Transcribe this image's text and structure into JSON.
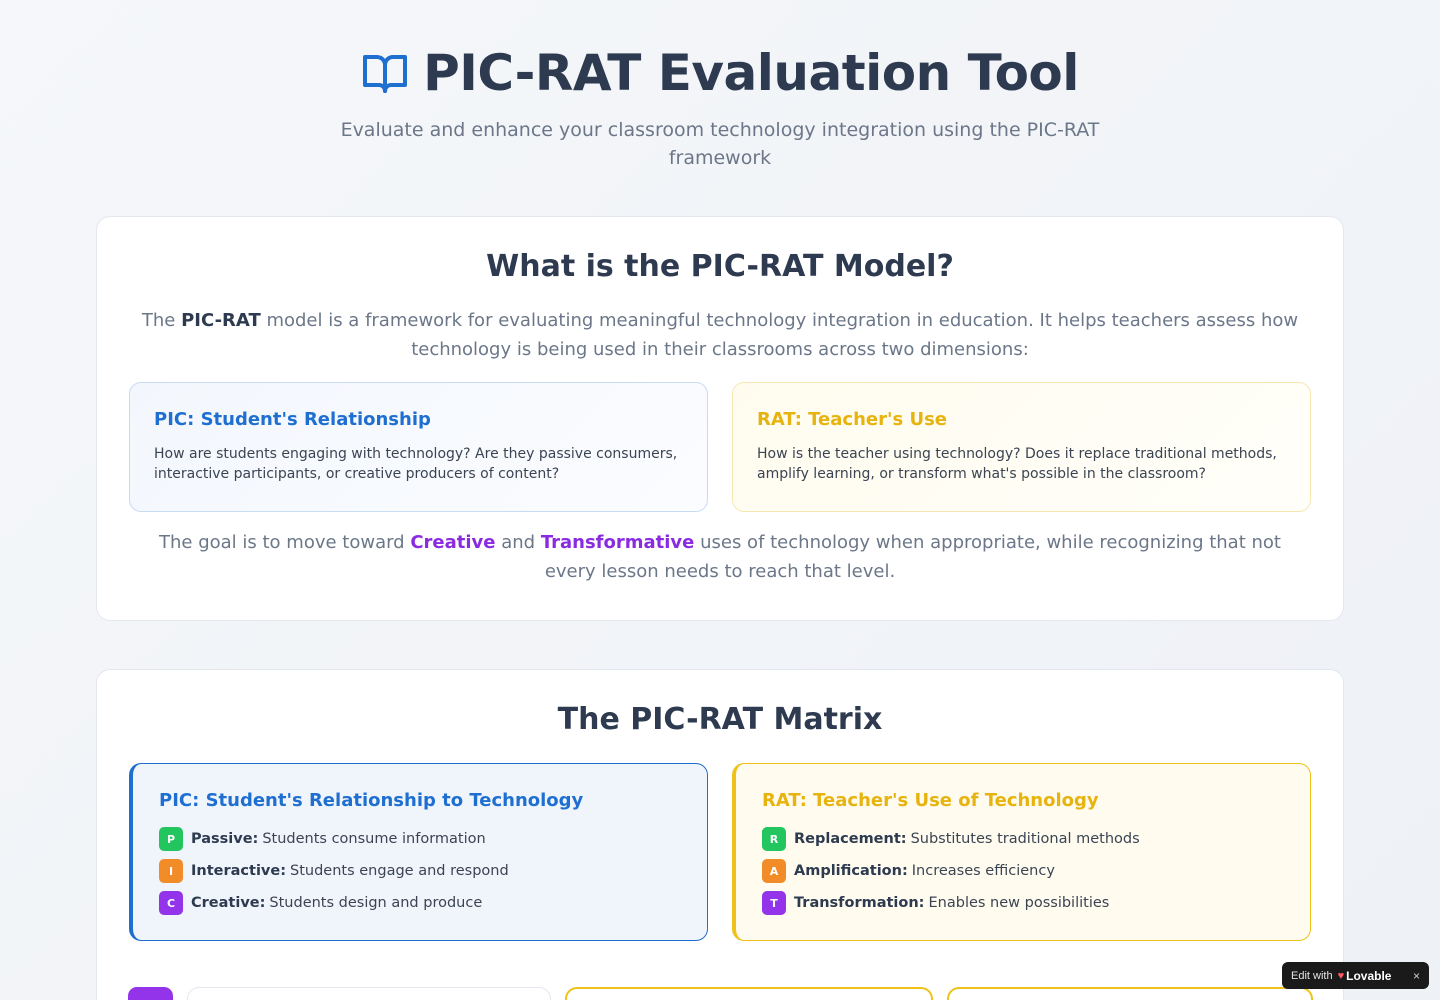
{
  "header": {
    "title": "PIC-RAT Evaluation Tool",
    "subtitle": "Evaluate and enhance your classroom technology integration using the PIC-RAT framework",
    "icon": "book-open-icon"
  },
  "about": {
    "heading": "What is the PIC-RAT Model?",
    "intro_pre": "The ",
    "intro_bold": "PIC-RAT",
    "intro_post": " model is a framework for evaluating meaningful technology integration in education. It helps teachers assess how technology is being used in their classrooms across two dimensions:",
    "pic": {
      "title": "PIC: Student's Relationship",
      "text": "How are students engaging with technology? Are they passive consumers, interactive participants, or creative producers of content?"
    },
    "rat": {
      "title": "RAT: Teacher's Use",
      "text": "How is the teacher using technology? Does it replace traditional methods, amplify learning, or transform what's possible in the classroom?"
    },
    "goal_pre": "The goal is to move toward ",
    "goal_h1": "Creative",
    "goal_mid": " and ",
    "goal_h2": "Transformative",
    "goal_post": " uses of technology when appropriate, while recognizing that not every lesson needs to reach that level."
  },
  "matrix": {
    "heading": "The PIC-RAT Matrix",
    "pic": {
      "title": "PIC: Student's Relationship to Technology",
      "items": [
        {
          "letter": "P",
          "label": "Passive:",
          "desc": "Students consume information"
        },
        {
          "letter": "I",
          "label": "Interactive:",
          "desc": "Students engage and respond"
        },
        {
          "letter": "C",
          "label": "Creative:",
          "desc": "Students design and produce"
        }
      ]
    },
    "rat": {
      "title": "RAT: Teacher's Use of Technology",
      "items": [
        {
          "letter": "R",
          "label": "Replacement:",
          "desc": "Substitutes traditional methods"
        },
        {
          "letter": "A",
          "label": "Amplification:",
          "desc": "Increases efficiency"
        },
        {
          "letter": "T",
          "label": "Transformation:",
          "desc": "Enables new possibilities"
        }
      ]
    }
  },
  "badge_widget": {
    "prefix": "Edit with",
    "brand": "Lovable",
    "close": "×"
  },
  "colors": {
    "pic_blue": "#1f6fd1",
    "rat_yellow": "#efc21a",
    "highlight_purple": "#8a2be2",
    "green": "#22c55e",
    "orange": "#f28c28",
    "purple": "#9333ea"
  }
}
